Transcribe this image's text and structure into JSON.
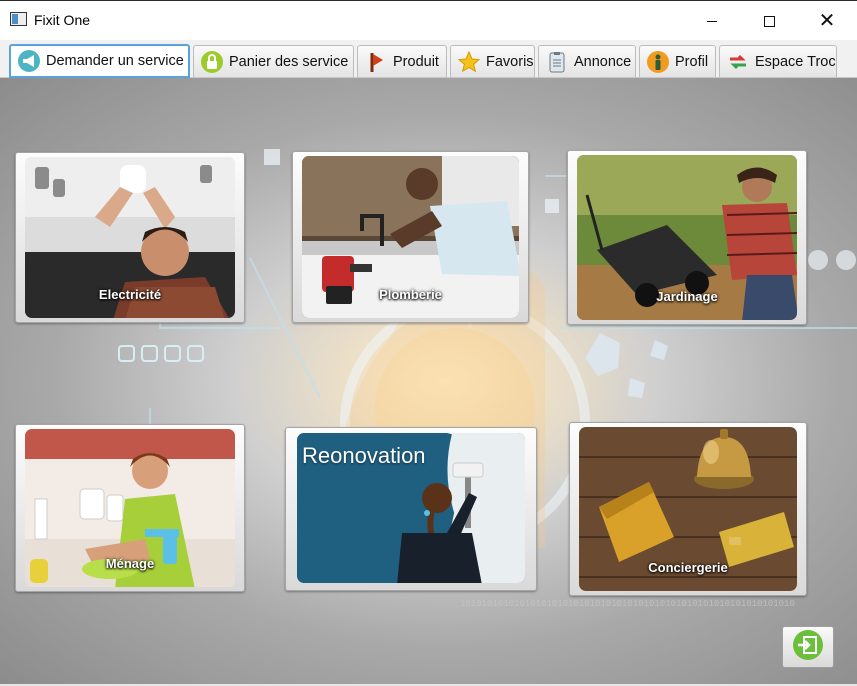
{
  "window": {
    "title": "Fixit One"
  },
  "tabs": [
    {
      "label": "Demander un service",
      "icon": "megaphone-icon"
    },
    {
      "label": "Panier des service",
      "icon": "lock-icon"
    },
    {
      "label": "Produit",
      "icon": "flag-icon"
    },
    {
      "label": "Favoris",
      "icon": "star-icon"
    },
    {
      "label": "Annonce",
      "icon": "clipboard-icon"
    },
    {
      "label": "Profil",
      "icon": "person-icon"
    },
    {
      "label": "Espace Troc",
      "icon": "exchange-icon"
    }
  ],
  "services": [
    {
      "label": "Electricité",
      "image": "electrician-photo"
    },
    {
      "label": "Plomberie",
      "image": "plumber-photo"
    },
    {
      "label": "Jardinage",
      "image": "gardener-photo"
    },
    {
      "label": "Ménage",
      "image": "cleaning-photo"
    },
    {
      "label": "Reonovation",
      "image": "painter-photo"
    },
    {
      "label": "Conciergerie",
      "image": "reception-bell-photo"
    }
  ],
  "exit": {
    "icon": "logout-icon"
  },
  "colors": {
    "active_tab_border": "#5aa3dd",
    "exit_green": "#6cbf3a"
  }
}
